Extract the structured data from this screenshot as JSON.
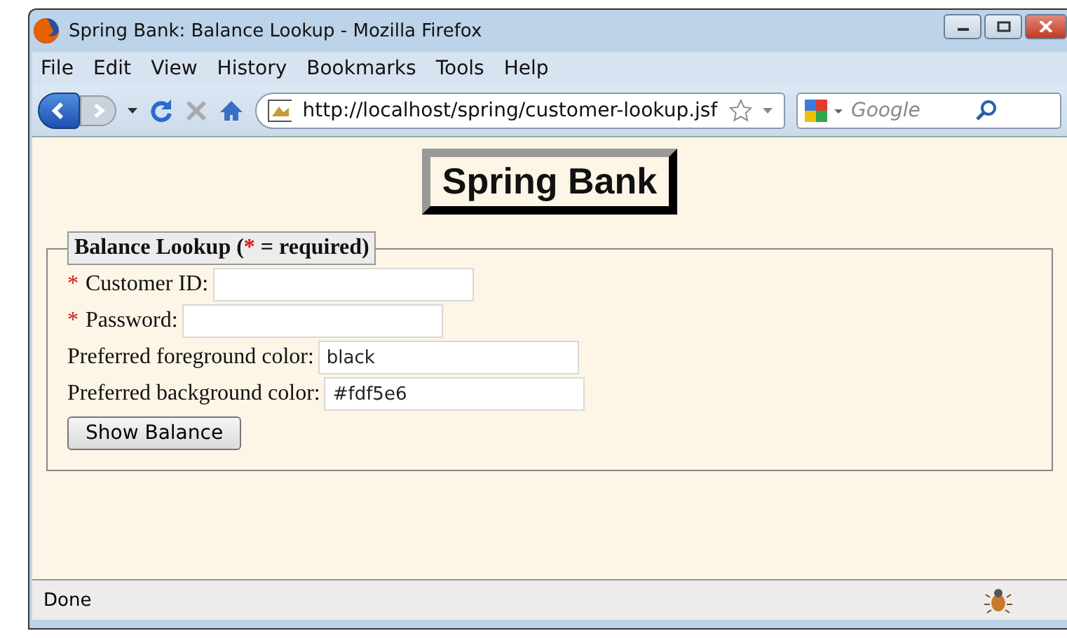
{
  "window": {
    "title": "Spring Bank: Balance Lookup - Mozilla Firefox"
  },
  "menu": [
    "File",
    "Edit",
    "View",
    "History",
    "Bookmarks",
    "Tools",
    "Help"
  ],
  "address_bar": {
    "value": "http://localhost/spring/customer-lookup.jsf"
  },
  "search": {
    "placeholder": "Google"
  },
  "page": {
    "heading": "Spring Bank",
    "legend": {
      "before": "Balance Lookup (",
      "mark": "*",
      "after": " = required)"
    },
    "fields": [
      {
        "label": "Customer ID:",
        "mark": "*",
        "kind": "text"
      },
      {
        "label": "Password:",
        "mark": "*",
        "kind": "password"
      },
      {
        "label": "Preferred foreground color:",
        "value": "black",
        "kind": "text"
      },
      {
        "label": "Preferred background color:",
        "value": "#fdf5e6",
        "kind": "text"
      }
    ],
    "button": "Show Balance"
  },
  "status_bar": {
    "text": "Done"
  }
}
